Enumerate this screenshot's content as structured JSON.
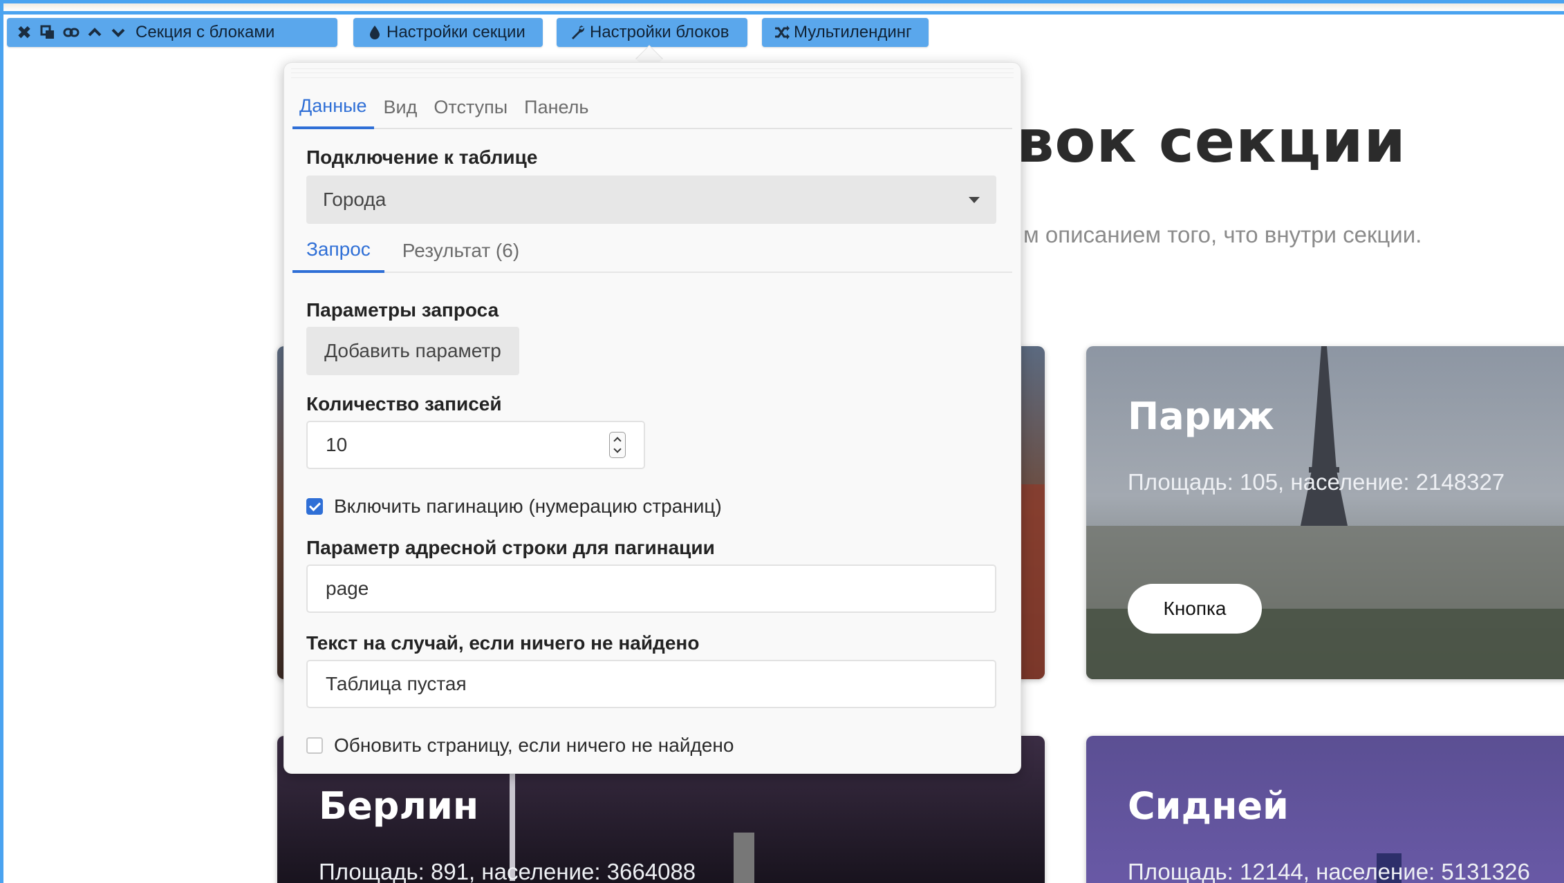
{
  "toolbar": {
    "section_label": "Секция с блоками",
    "section_settings_label": "Настройки секции",
    "block_settings_label": "Настройки блоков",
    "multilanding_label": "Мультилендинг",
    "accent_color": "#5aa7ec"
  },
  "page": {
    "heading_visible": "вок секции",
    "subtitle_visible": "м описанием того, что внутри секции."
  },
  "cards": {
    "paris": {
      "title": "Париж",
      "stats": "Площадь: 105, население: 2148327",
      "button": "Кнопка"
    },
    "berlin": {
      "title": "Берлин",
      "stats": "Площадь: 891, население: 3664088"
    },
    "sydney": {
      "title": "Сидней",
      "stats": "Площадь: 12144, население: 5131326"
    }
  },
  "panel": {
    "tabs": [
      "Данные",
      "Вид",
      "Отступы",
      "Панель"
    ],
    "active_tab": "Данные",
    "table_connection_label": "Подключение к таблице",
    "table_selected": "Города",
    "subtabs": [
      "Запрос",
      "Результат (6)"
    ],
    "active_subtab": "Запрос",
    "query_params_label": "Параметры запроса",
    "add_param_button": "Добавить параметр",
    "records_count_label": "Количество записей",
    "records_count_value": "10",
    "pagination_checkbox_label": "Включить пагинацию (нумерацию страниц)",
    "pagination_checked": true,
    "pagination_param_label": "Параметр адресной строки для пагинации",
    "pagination_param_value": "page",
    "empty_text_label": "Текст на случай, если ничего не найдено",
    "empty_text_value": "Таблица пустая",
    "refresh_checkbox_label": "Обновить страницу, если ничего не найдено",
    "refresh_checked": false,
    "accent_color": "#2f6fd6"
  }
}
